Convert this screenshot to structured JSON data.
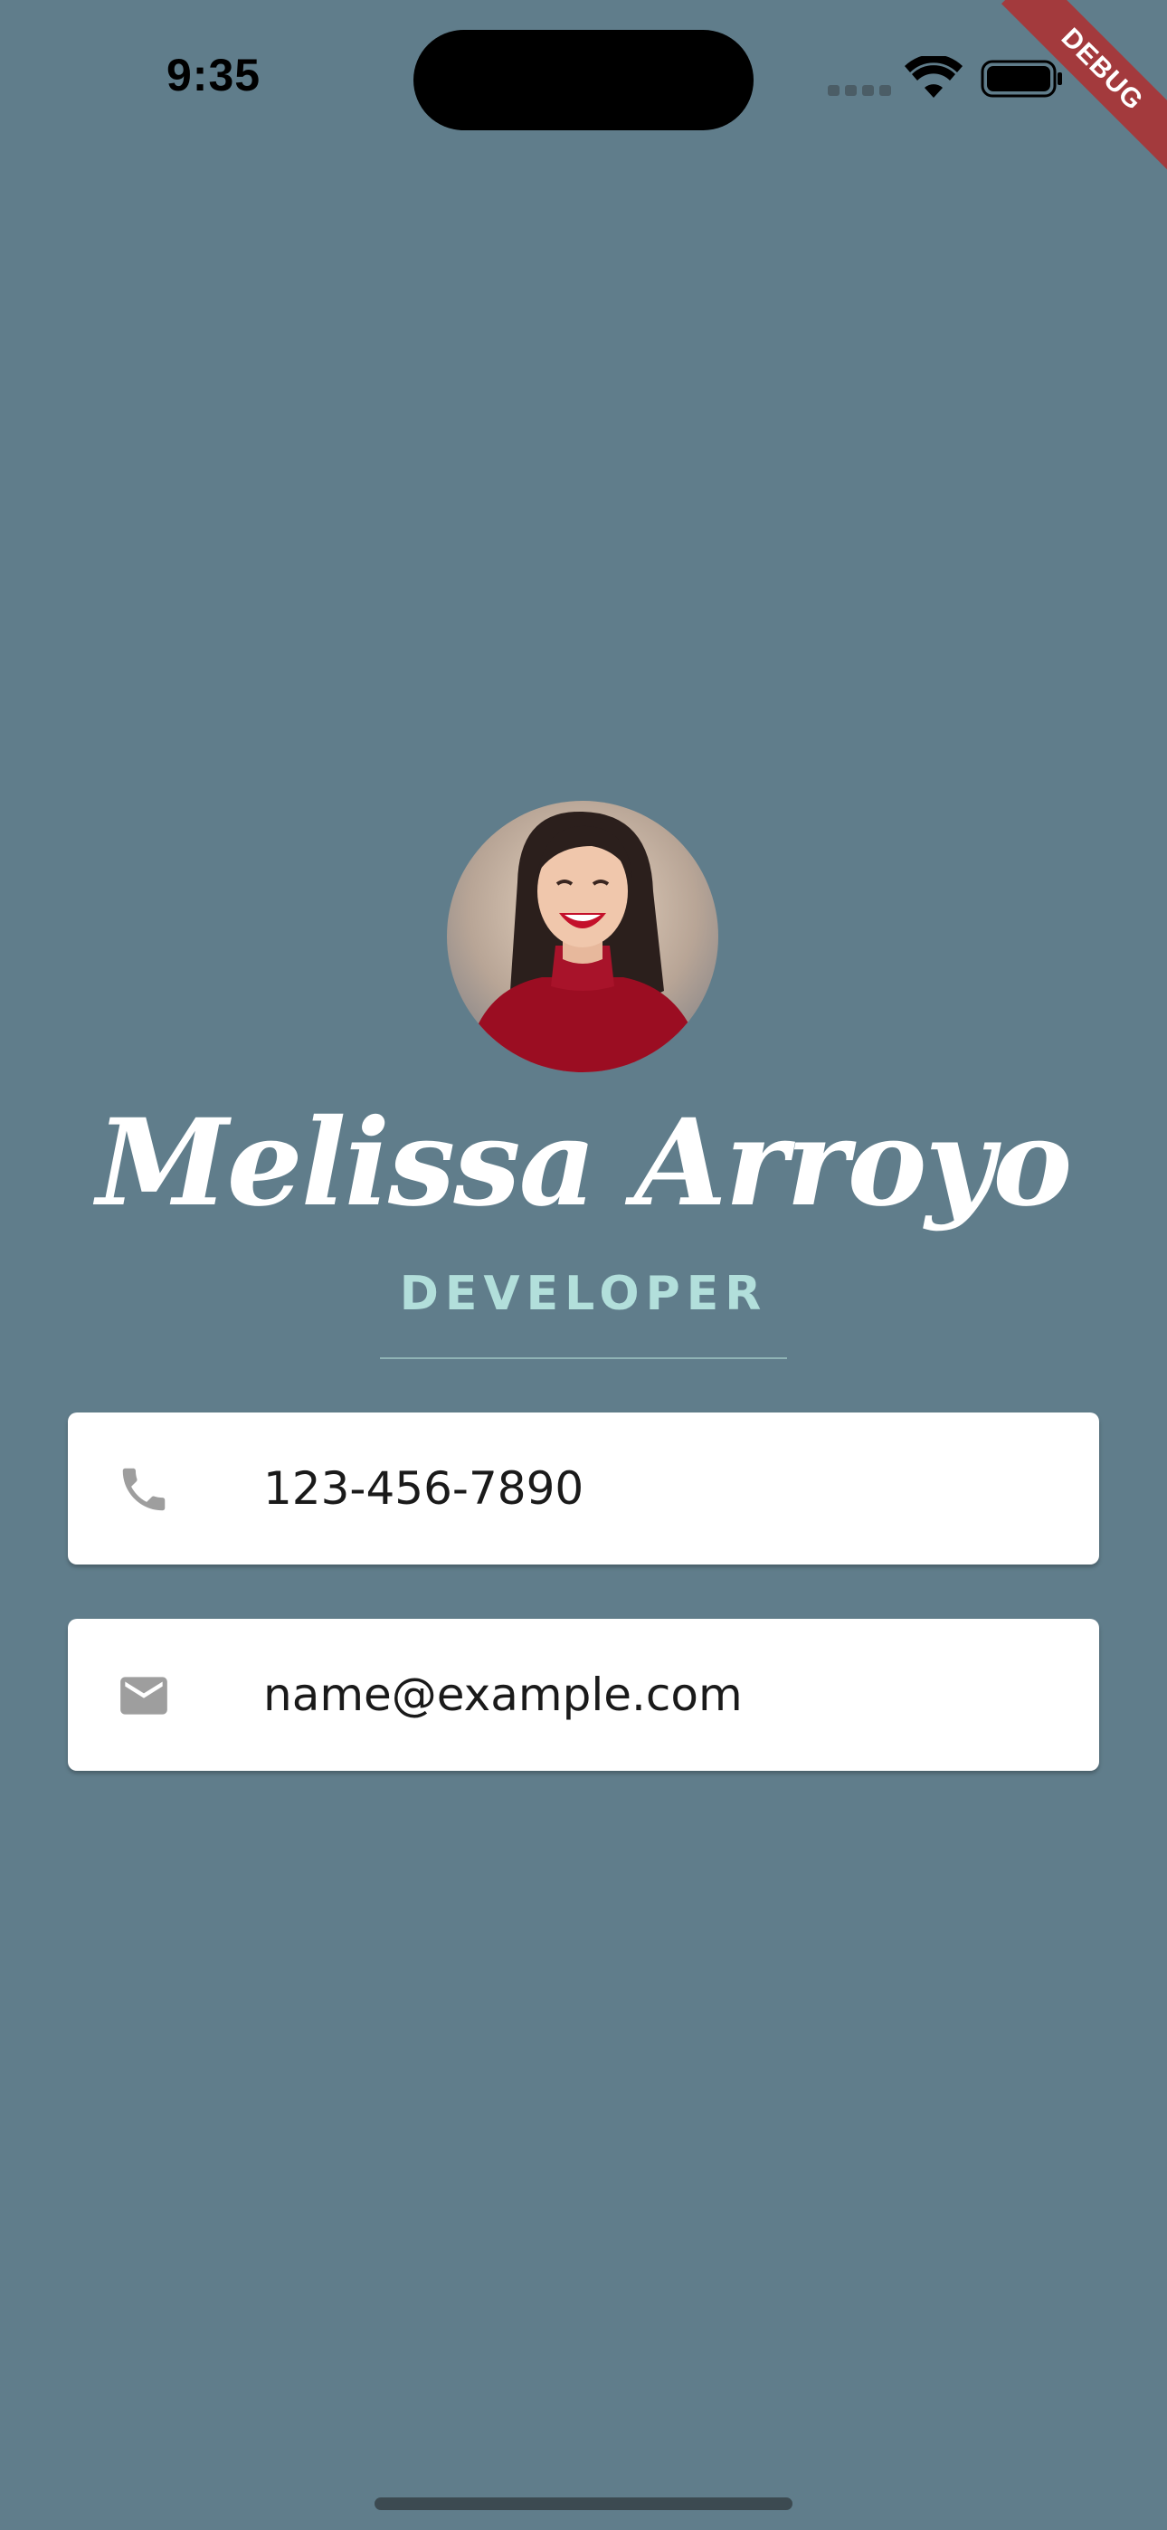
{
  "status_bar": {
    "time": "9:35",
    "wifi_icon": "wifi-icon",
    "battery_icon": "battery-icon"
  },
  "debug_banner": "DEBUG",
  "profile": {
    "avatar_icon": "profile-photo",
    "name": "Melissa Arroyo",
    "title": "DEVELOPER"
  },
  "contacts": {
    "phone": {
      "icon": "phone-icon",
      "value": "123-456-7890"
    },
    "email": {
      "icon": "mail-icon",
      "value": "name@example.com"
    }
  },
  "colors": {
    "background": "#607d8b",
    "title": "#b2dfdb",
    "card": "#ffffff",
    "icon": "#9e9e9e",
    "debug": "#a33a3d"
  }
}
